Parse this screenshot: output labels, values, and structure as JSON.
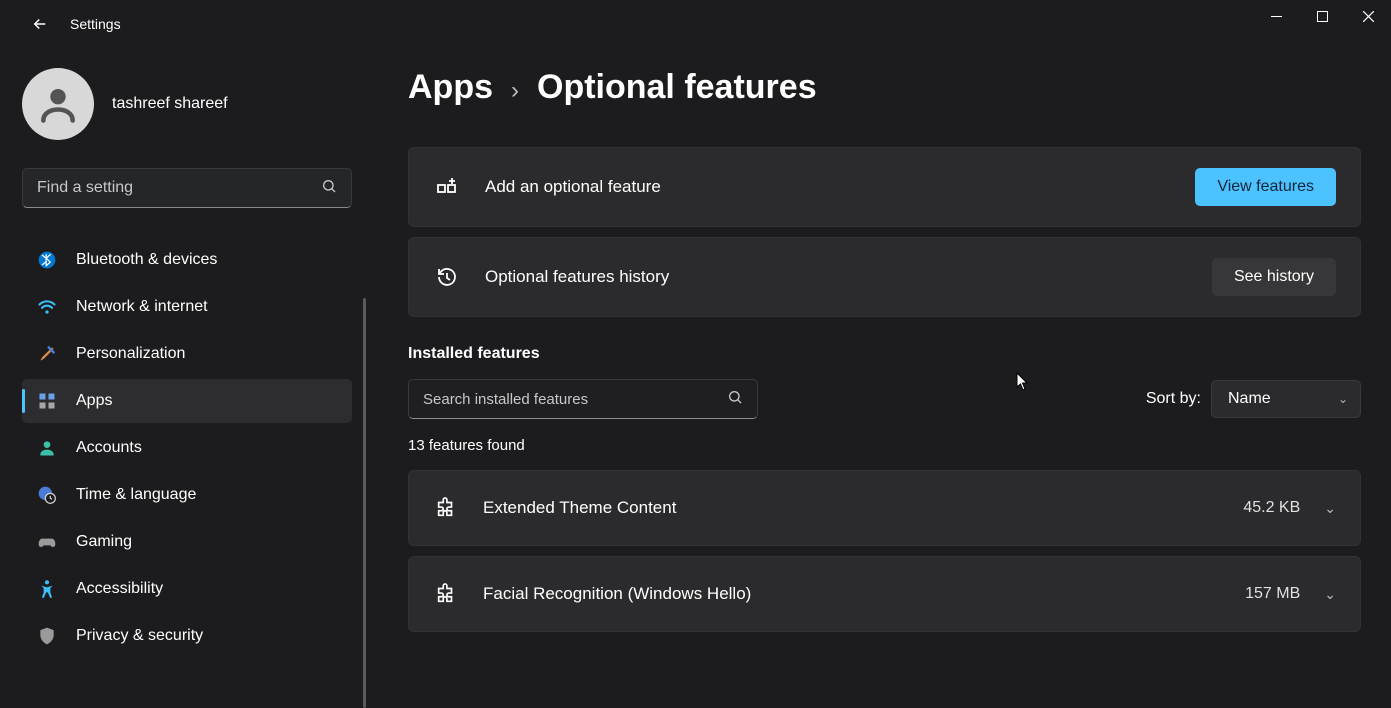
{
  "window": {
    "title": "Settings"
  },
  "profile": {
    "username": "tashreef shareef"
  },
  "search": {
    "placeholder": "Find a setting"
  },
  "nav": {
    "items": [
      {
        "label": "Bluetooth & devices"
      },
      {
        "label": "Network & internet"
      },
      {
        "label": "Personalization"
      },
      {
        "label": "Apps"
      },
      {
        "label": "Accounts"
      },
      {
        "label": "Time & language"
      },
      {
        "label": "Gaming"
      },
      {
        "label": "Accessibility"
      },
      {
        "label": "Privacy & security"
      }
    ],
    "active_index": 3
  },
  "breadcrumb": {
    "parent": "Apps",
    "current": "Optional features"
  },
  "cards": {
    "add": {
      "label": "Add an optional feature",
      "button": "View features"
    },
    "history": {
      "label": "Optional features history",
      "button": "See history"
    }
  },
  "installed": {
    "heading": "Installed features",
    "search_placeholder": "Search installed features",
    "sort_label": "Sort by:",
    "sort_value": "Name",
    "count_text": "13 features found",
    "features": [
      {
        "name": "Extended Theme Content",
        "size": "45.2 KB"
      },
      {
        "name": "Facial Recognition (Windows Hello)",
        "size": "157 MB"
      }
    ]
  },
  "colors": {
    "accent": "#4cc2ff"
  }
}
